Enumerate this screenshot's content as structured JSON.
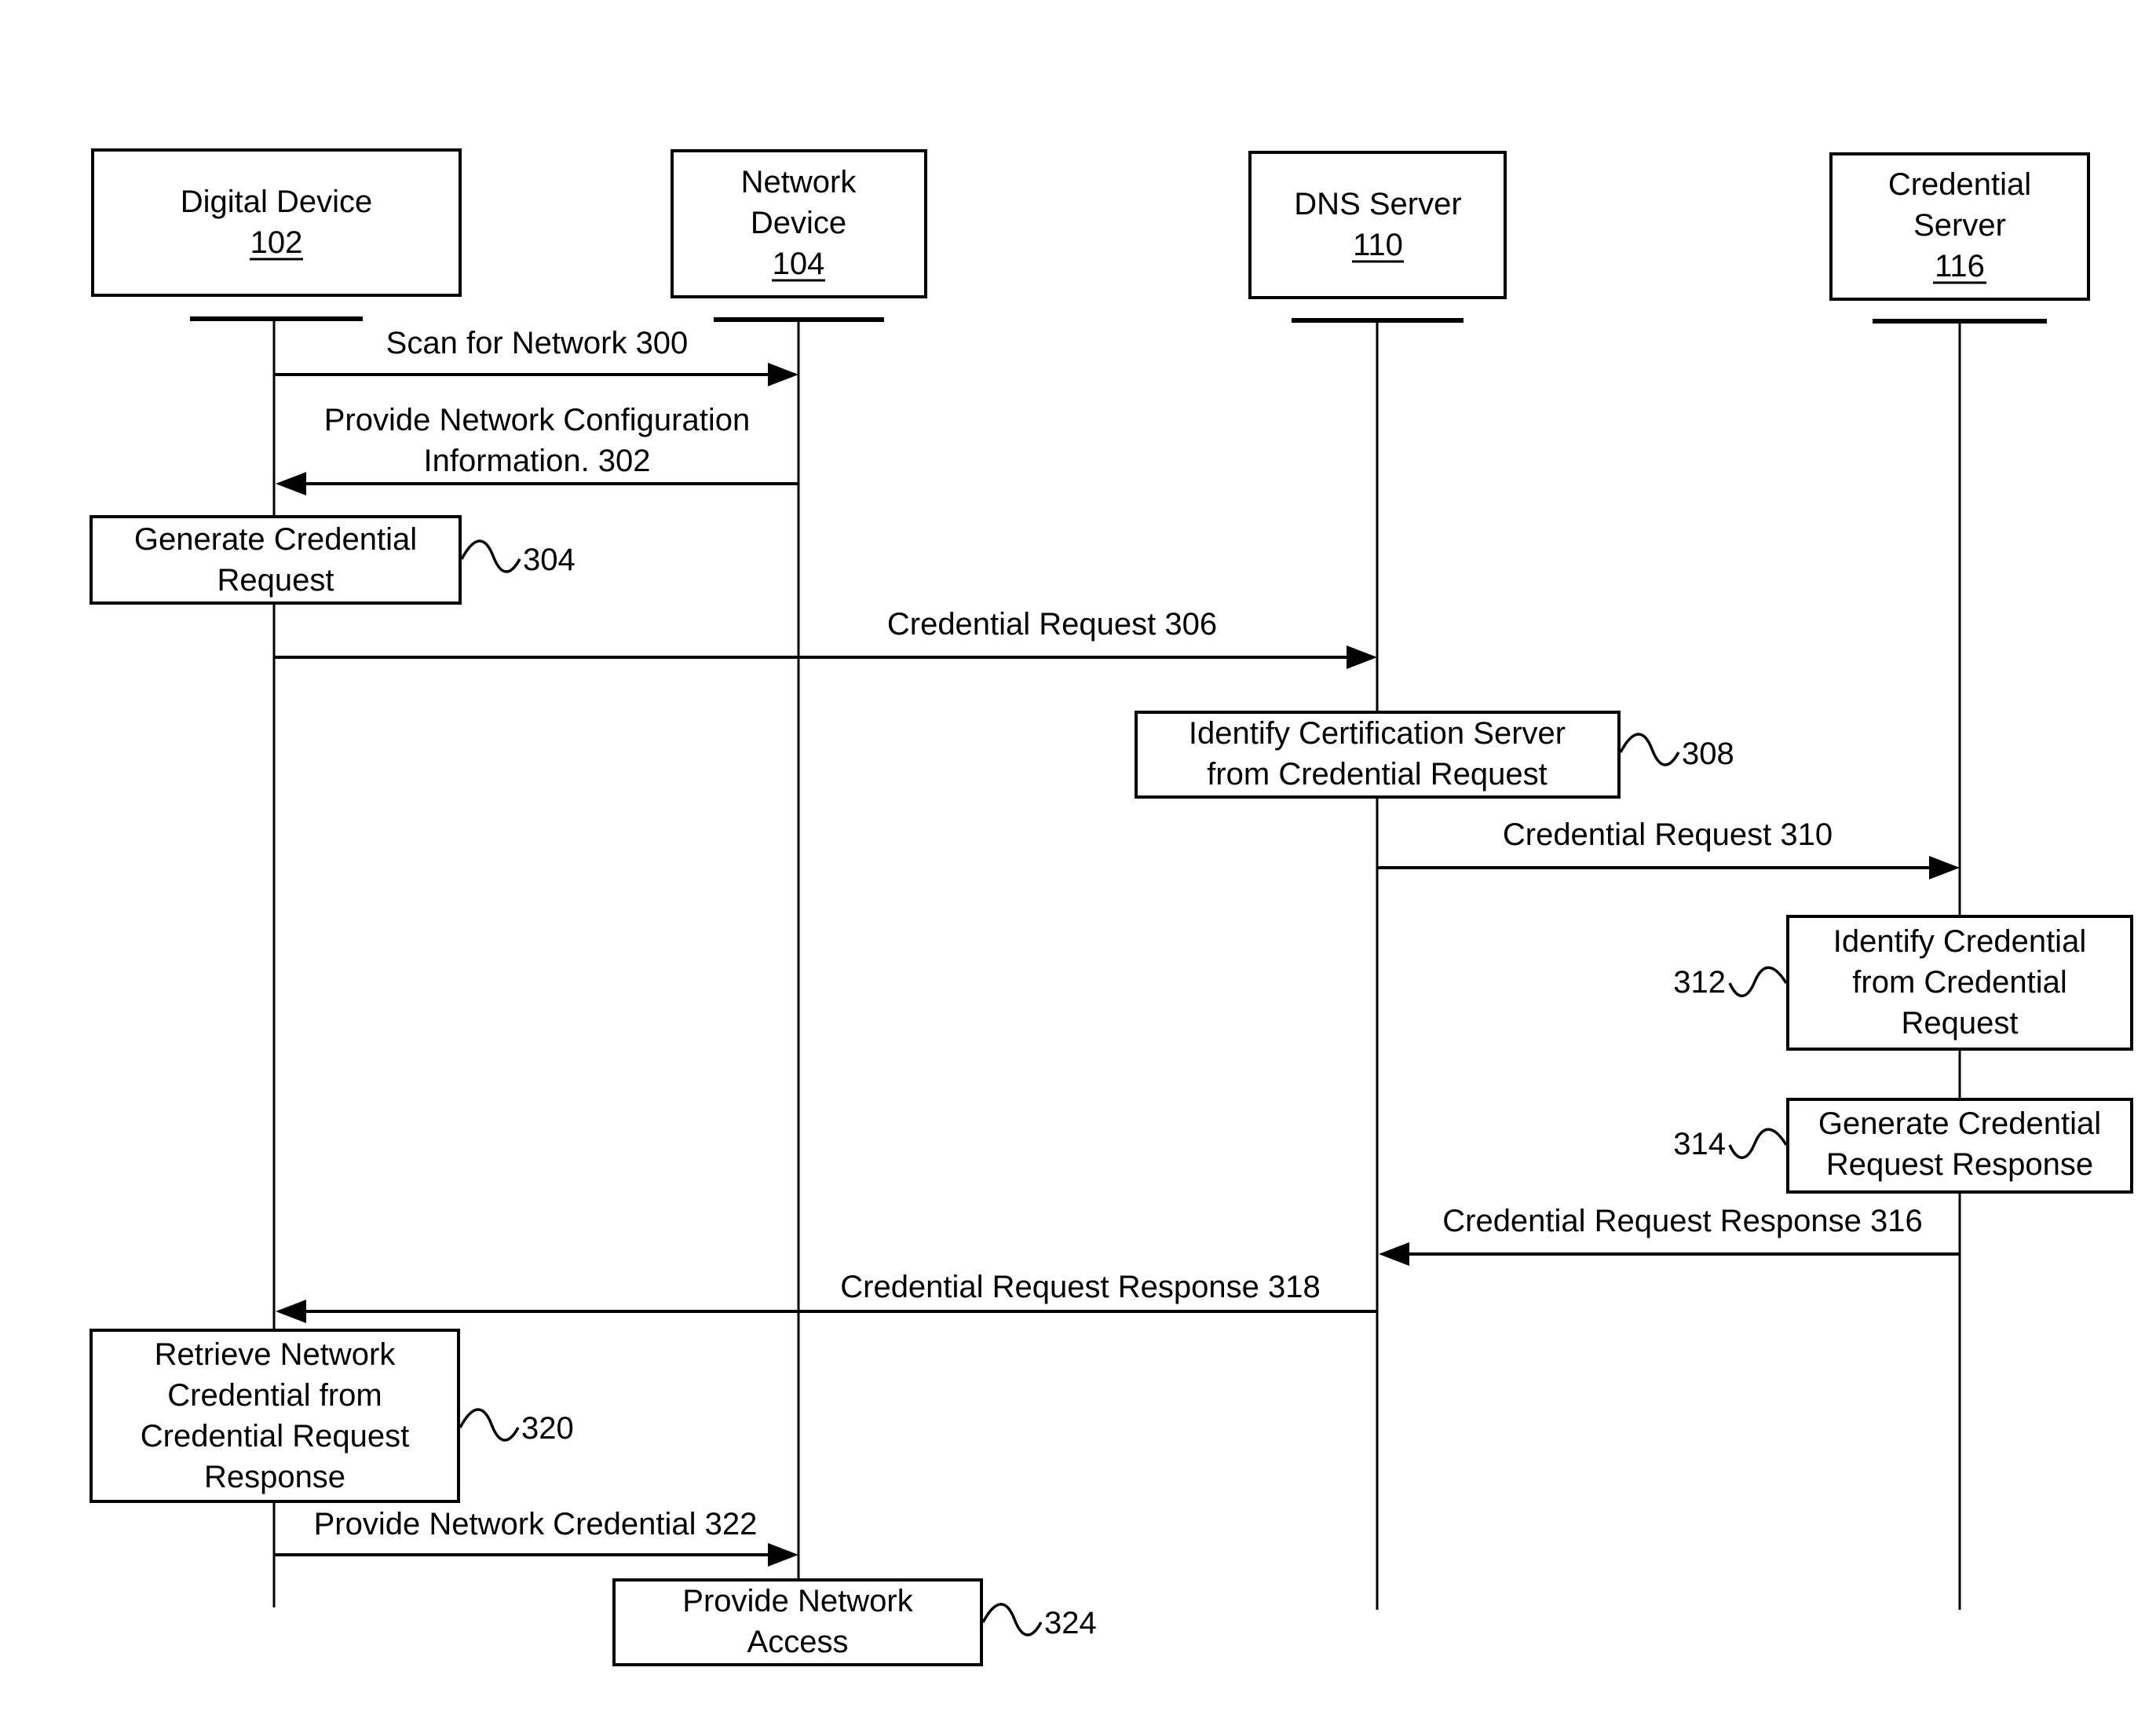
{
  "diagram": {
    "type": "sequence-diagram",
    "participants": [
      {
        "name": "Digital Device",
        "name_lines": [
          "Digital Device"
        ],
        "ref": "102"
      },
      {
        "name": "Network Device",
        "name_lines": [
          "Network",
          "Device"
        ],
        "ref": "104"
      },
      {
        "name": "DNS Server",
        "name_lines": [
          "DNS Server"
        ],
        "ref": "110"
      },
      {
        "name": "Credential Server",
        "name_lines": [
          "Credential",
          "Server"
        ],
        "ref": "116"
      }
    ],
    "messages": [
      {
        "id": "300",
        "from": "Digital Device",
        "to": "Network Device",
        "lines": [
          "Scan for Network 300"
        ]
      },
      {
        "id": "302",
        "from": "Network Device",
        "to": "Digital Device",
        "lines": [
          "Provide Network Configuration",
          "Information. 302"
        ]
      },
      {
        "id": "306",
        "from": "Digital Device",
        "to": "DNS Server",
        "lines": [
          "Credential Request 306"
        ]
      },
      {
        "id": "310",
        "from": "DNS Server",
        "to": "Credential Server",
        "lines": [
          "Credential Request 310"
        ]
      },
      {
        "id": "316",
        "from": "Credential Server",
        "to": "DNS Server",
        "lines": [
          "Credential Request Response 316"
        ]
      },
      {
        "id": "318",
        "from": "DNS Server",
        "to": "Digital Device",
        "lines": [
          "Credential Request Response 318"
        ]
      },
      {
        "id": "322",
        "from": "Digital Device",
        "to": "Network Device",
        "lines": [
          "Provide Network Credential 322"
        ]
      }
    ],
    "activities": [
      {
        "id": "304",
        "on": "Digital Device",
        "lines": [
          "Generate Credential",
          "Request"
        ],
        "ref": "304"
      },
      {
        "id": "308",
        "on": "DNS Server",
        "lines": [
          "Identify Certification Server",
          "from Credential Request"
        ],
        "ref": "308"
      },
      {
        "id": "312",
        "on": "Credential Server",
        "lines": [
          "Identify Credential",
          "from Credential",
          "Request"
        ],
        "ref": "312"
      },
      {
        "id": "314",
        "on": "Credential Server",
        "lines": [
          "Generate Credential",
          "Request Response"
        ],
        "ref": "314"
      },
      {
        "id": "320",
        "on": "Digital Device",
        "lines": [
          "Retrieve Network",
          "Credential from",
          "Credential Request",
          "Response"
        ],
        "ref": "320"
      },
      {
        "id": "324",
        "on": "Network Device",
        "lines": [
          "Provide Network",
          "Access"
        ],
        "ref": "324"
      }
    ]
  }
}
